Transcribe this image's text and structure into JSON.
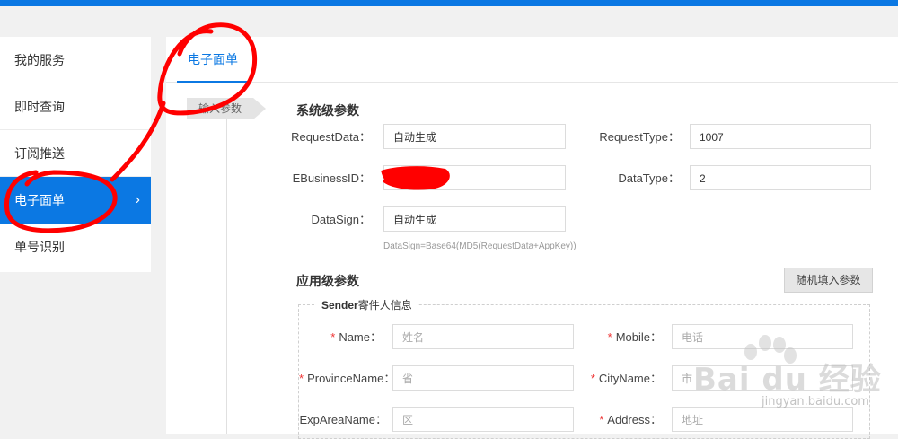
{
  "sidebar": {
    "items": [
      {
        "label": "我的服务"
      },
      {
        "label": "即时查询"
      },
      {
        "label": "订阅推送"
      },
      {
        "label": "电子面单",
        "chevron": "›"
      },
      {
        "label": "单号识别"
      }
    ]
  },
  "tab": {
    "label": "电子面单"
  },
  "step": {
    "label": "输入参数"
  },
  "system_params": {
    "title": "系统级参数",
    "fields": {
      "request_data": {
        "label": "RequestData：",
        "value": "自动生成"
      },
      "request_type": {
        "label": "RequestType：",
        "value": "1007"
      },
      "ebusiness_id": {
        "label": "EBusinessID：",
        "value": ""
      },
      "data_type": {
        "label": "DataType：",
        "value": "2"
      },
      "data_sign": {
        "label": "DataSign：",
        "value": "自动生成"
      }
    },
    "hint": "DataSign=Base64(MD5(RequestData+AppKey))"
  },
  "app_params": {
    "title": "应用级参数",
    "random_button": "随机填入参数",
    "sender_legend_bold": "Sender",
    "sender_legend_rest": "寄件人信息",
    "fields": {
      "name": {
        "label": "Name：",
        "placeholder": "姓名",
        "required": "*"
      },
      "mobile": {
        "label": "Mobile：",
        "placeholder": "电话",
        "required": "*"
      },
      "province": {
        "label": "ProvinceName：",
        "placeholder": "省",
        "required": "*"
      },
      "city": {
        "label": "CityName：",
        "placeholder": "市",
        "required": "*"
      },
      "exp_area": {
        "label": "ExpAreaName：",
        "placeholder": "区"
      },
      "address": {
        "label": "Address：",
        "placeholder": "地址",
        "required": "*"
      }
    }
  },
  "watermark": {
    "text": "Bai du 经验",
    "sub": "jingyan.baidu.com"
  },
  "colors": {
    "accent": "#0b78e3",
    "annotation": "#ff0000"
  }
}
